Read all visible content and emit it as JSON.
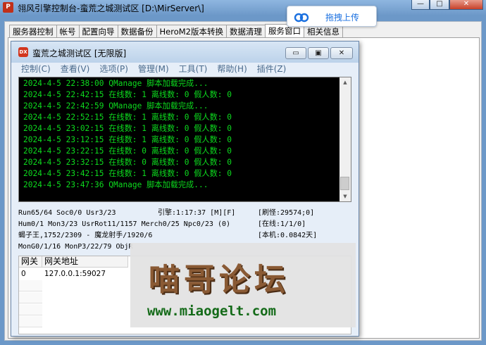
{
  "outer_window": {
    "title": "翎风引擎控制台-蛮荒之城测试区 [D:\\MirServer\\]",
    "app_icon_text": "P",
    "min": "—",
    "max": "□",
    "close": "✕"
  },
  "upload_popup": {
    "label": "拖拽上传",
    "icon": "cloud-icon"
  },
  "tabs": [
    "服务器控制",
    "帐号",
    "配置向导",
    "数据备份",
    "HeroM2版本转换",
    "数据清理",
    "服务窗口",
    "相关信息"
  ],
  "inner_window": {
    "title": "蛮荒之城测试区 [无限版]",
    "app_icon_text": "DX",
    "min": "▭",
    "max": "▣",
    "close": "✕"
  },
  "menu": [
    "控制(C)",
    "查看(V)",
    "选项(P)",
    "管理(M)",
    "工具(T)",
    "帮助(H)",
    "插件(Z)"
  ],
  "log": [
    "2024-4-5 22:38:00 QManage 脚本加载完成...",
    "2024-4-5 22:42:15 在线数: 1 离线数: 0 假人数: 0",
    "2024-4-5 22:42:59 QManage 脚本加载完成...",
    "2024-4-5 22:52:15 在线数: 1 离线数: 0 假人数: 0",
    "2024-4-5 23:02:15 在线数: 1 离线数: 0 假人数: 0",
    "2024-4-5 23:12:15 在线数: 1 离线数: 0 假人数: 0",
    "2024-4-5 23:22:15 在线数: 0 离线数: 0 假人数: 0",
    "2024-4-5 23:32:15 在线数: 0 离线数: 0 假人数: 0",
    "2024-4-5 23:42:15 在线数: 1 离线数: 0 假人数: 0",
    "2024-4-5 23:47:36 QManage 脚本加载完成..."
  ],
  "status": {
    "run": "Run65/64 Soc0/0 Usr3/23",
    "engine": "引擎:1:17:37 [M][F]",
    "monsters": "[刷怪:29574;0]",
    "hum": "Hum0/1 Mon3/23 UsrRot11/1157 Merch0/25 Npc0/23 (0)",
    "online": "[在线:1/1/0]",
    "player": "蝎子王,1752/2309 - 魔龙射手/1920/6",
    "local": "[本机:0.0842天]",
    "mon": "MonG0/1/16 MonP3/22/79 ObjR"
  },
  "gateway": {
    "col_gate": "网关",
    "col_addr": "网关地址",
    "rows": [
      {
        "id": "0",
        "addr": "127.0.0.1:59027"
      }
    ]
  },
  "watermark": {
    "title": "喵哥论坛",
    "url": "www.miaogelt.com"
  }
}
